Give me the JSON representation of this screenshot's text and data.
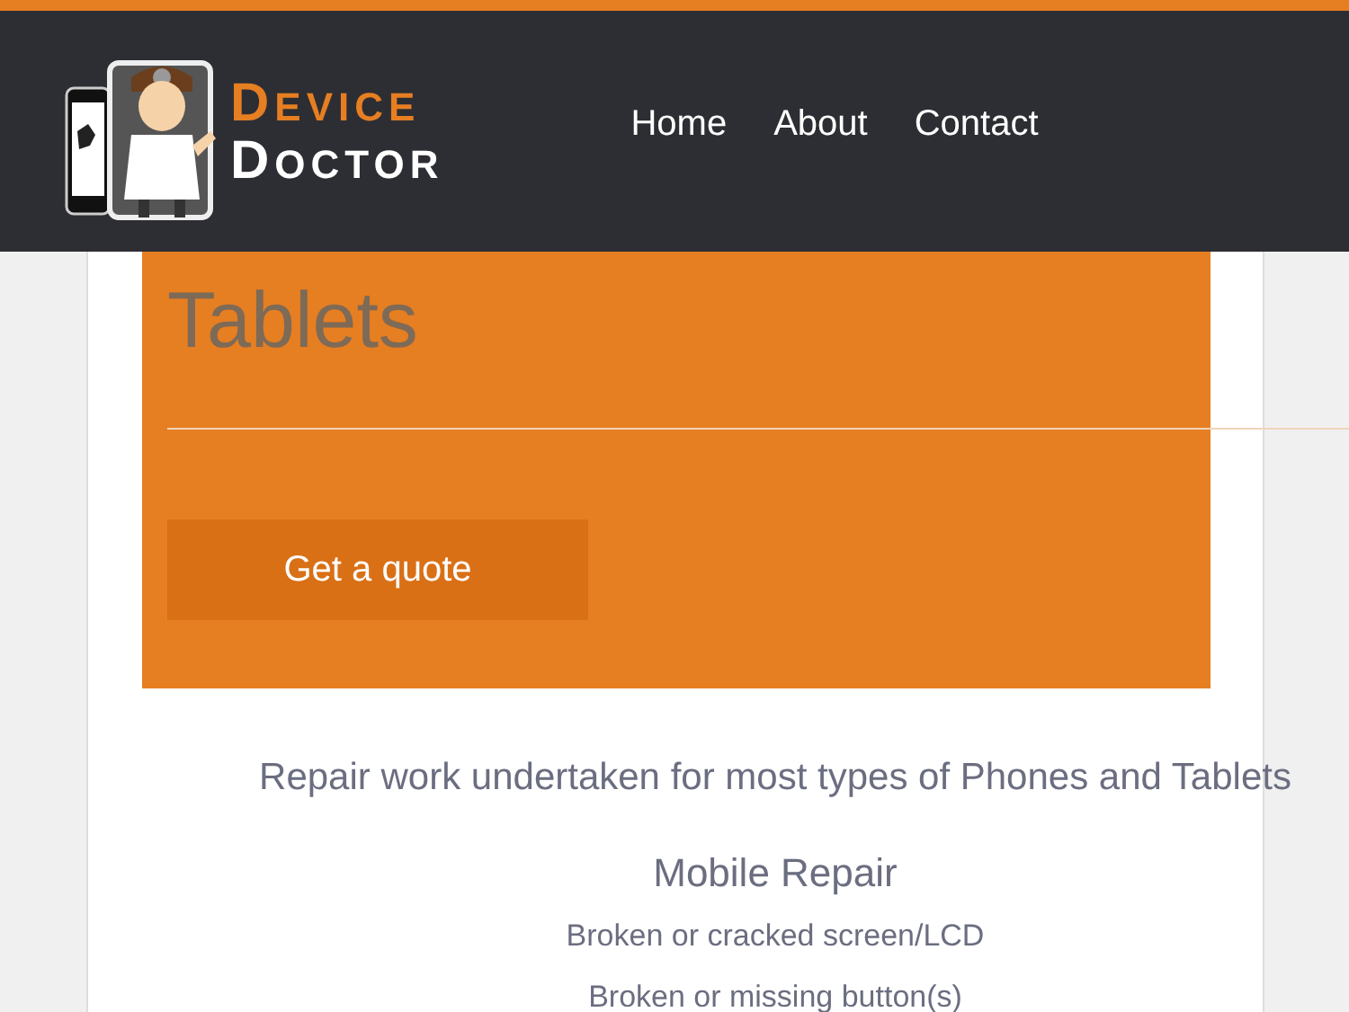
{
  "header": {
    "logo": {
      "line_1": "DEVICE",
      "line_2": "DOCTOR"
    },
    "nav": [
      {
        "label": "Home"
      },
      {
        "label": "About"
      },
      {
        "label": "Contact"
      }
    ]
  },
  "hero": {
    "heading": "Tablets",
    "button": "Get a quote"
  },
  "intro": "Repair work undertaken for most types of Phones and Tablets",
  "section": {
    "title": "Mobile Repair",
    "items": [
      "Broken or cracked screen/LCD",
      "Broken or missing button(s)"
    ]
  }
}
